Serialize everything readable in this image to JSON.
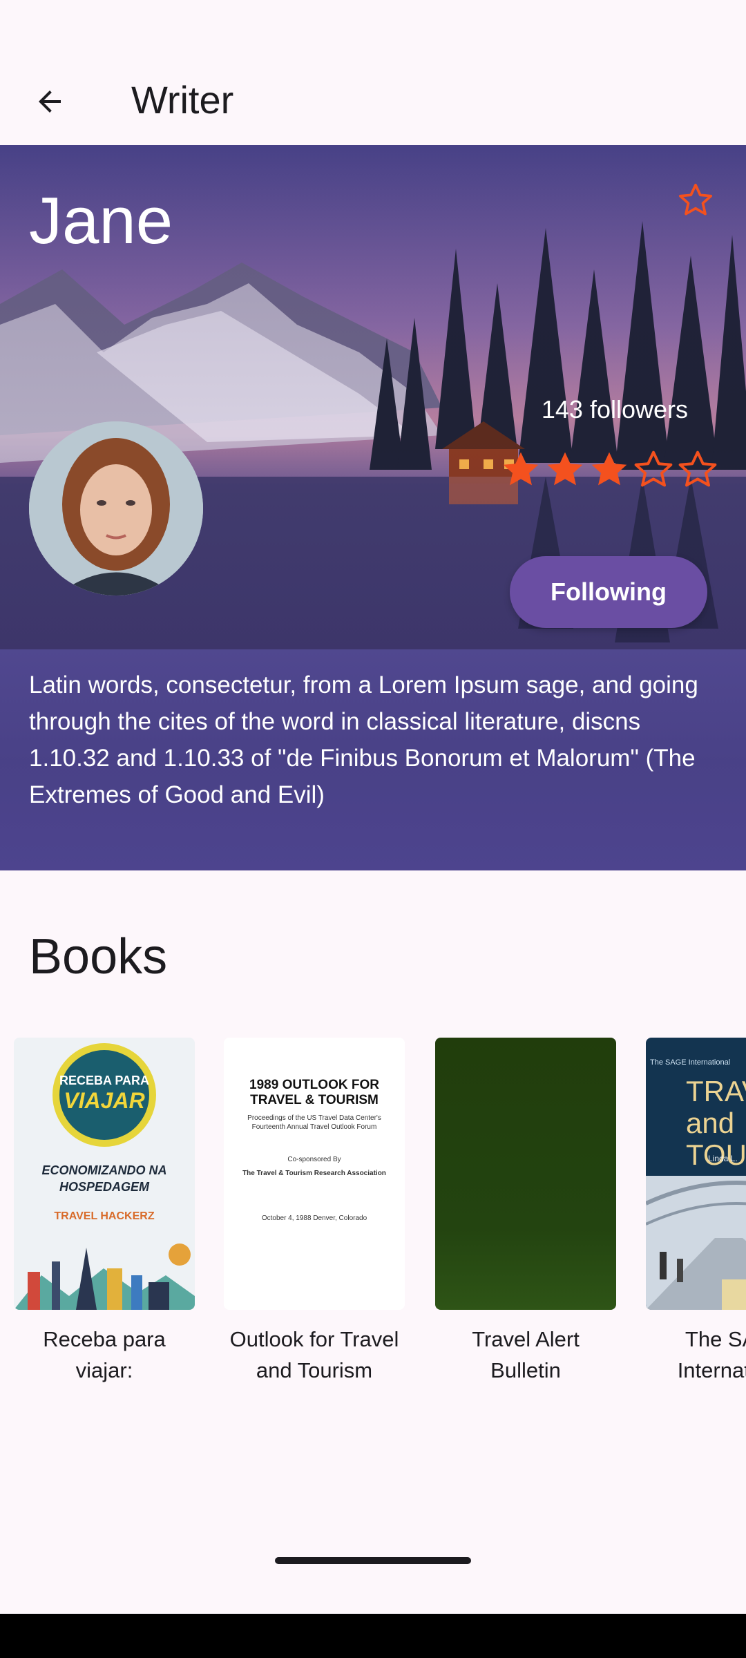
{
  "app_bar": {
    "back_icon": "arrow-left-icon",
    "title": "Writer"
  },
  "writer": {
    "name": "Jane",
    "favorite_icon": "star-outline-icon",
    "followers_text": "143 followers",
    "rating": 3,
    "rating_max": 5,
    "follow_button_label": "Following",
    "bio": "Latin words, consectetur, from a Lorem Ipsum sage, and going through the cites of the word in classical literature, discns 1.10.32 and 1.10.33 of \"de Finibus Bonorum et Malorum\" (The Extremes of Good and Evil)"
  },
  "books": {
    "heading": "Books",
    "items": [
      {
        "title": "Receba para\nviajar:",
        "cover_text": {
          "line1": "RECEBA PARA",
          "line2": "VIAJAR",
          "line3": "ECONOMIZANDO NA HOSPEDAGEM",
          "line4": "TRAVEL HACKERZ"
        }
      },
      {
        "title": "Outlook for Travel\nand Tourism",
        "cover_text": {
          "line1": "1989 OUTLOOK FOR TRAVEL & TOURISM",
          "line2": "Proceedings of the US Travel Data Center's Fourteenth Annual Travel Outlook Forum",
          "line3": "Co-sponsored By",
          "line4": "The Travel & Tourism Research Association",
          "line5": "October 4, 1988 Denver, Colorado"
        }
      },
      {
        "title": "Travel Alert\nBulletin"
      },
      {
        "title": "The SAGE\nInternational",
        "cover_text": {
          "line1": "The SAGE International",
          "line2": "TRAVEL and TOURISM",
          "line3": "Linda L."
        }
      }
    ]
  },
  "colors": {
    "accent_star": "#f4511e",
    "follow_button": "#6a4ea3",
    "background": "#fdf7fb"
  }
}
